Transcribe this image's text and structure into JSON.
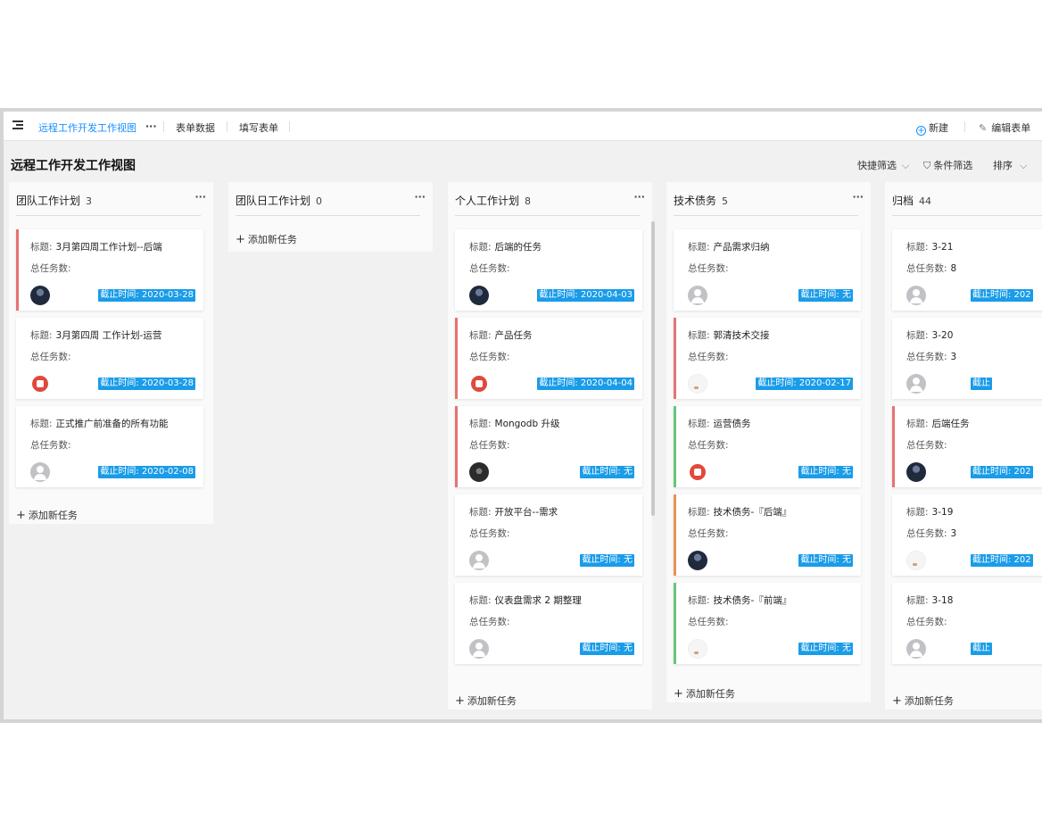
{
  "topbar": {
    "view_name": "远程工作开发工作视图",
    "more": "···",
    "tabs": [
      "表单数据",
      "填写表单"
    ],
    "new_label": "新建",
    "edit_label": "编辑表单"
  },
  "page": {
    "title": "远程工作开发工作视图",
    "quick_filter": "快捷筛选",
    "condition_filter": "条件筛选",
    "sort": "排序"
  },
  "labels": {
    "title_key": "标题:",
    "total_key": "总任务数:",
    "due_prefix": "截止时间:",
    "add_task": "添加新任务"
  },
  "columns": [
    {
      "name": "团队工作计划",
      "count": "3",
      "cards": [
        {
          "title": "3月第四周工作计划--后端",
          "total": "",
          "due": "截止时间: 2020-03-28",
          "bar": "#e57373",
          "avatar": "photo"
        },
        {
          "title": "3月第四周 工作计划-运营",
          "total": "",
          "due": "截止时间: 2020-03-28",
          "bar": "",
          "avatar": "logo"
        },
        {
          "title": "正式推广前准备的所有功能",
          "total": "",
          "due": "截止时间: 2020-02-08",
          "bar": "",
          "avatar": "default"
        }
      ]
    },
    {
      "name": "团队日工作计划",
      "count": "0",
      "cards": []
    },
    {
      "name": "个人工作计划",
      "count": "8",
      "cards": [
        {
          "title": "后端的任务",
          "total": "",
          "due": "截止时间: 2020-04-03",
          "bar": "",
          "avatar": "photo"
        },
        {
          "title": "产品任务",
          "total": "",
          "due": "截止时间: 2020-04-04",
          "bar": "#e57373",
          "avatar": "logo"
        },
        {
          "title": "Mongodb 升级",
          "total": "",
          "due": "截止时间: 无",
          "bar": "#e57373",
          "avatar": "dark"
        },
        {
          "title": "开放平台--需求",
          "total": "",
          "due": "截止时间: 无",
          "bar": "",
          "avatar": "default"
        },
        {
          "title": "仪表盘需求 2 期整理",
          "total": "",
          "due": "截止时间: 无",
          "bar": "",
          "avatar": "default"
        }
      ]
    },
    {
      "name": "技术债务",
      "count": "5",
      "cards": [
        {
          "title": "产品需求归纳",
          "total": "",
          "due": "截止时间: 无",
          "bar": "",
          "avatar": "default"
        },
        {
          "title": "郭清技术交接",
          "total": "",
          "due": "截止时间: 2020-02-17",
          "bar": "#e57373",
          "avatar": "white"
        },
        {
          "title": "运营债务",
          "total": "",
          "due": "截止时间: 无",
          "bar": "#66c77a",
          "avatar": "logo"
        },
        {
          "title": "技术债务-『后端』",
          "total": "",
          "due": "截止时间: 无",
          "bar": "#e8935a",
          "avatar": "photo"
        },
        {
          "title": "技术债务-『前端』",
          "total": "",
          "due": "截止时间: 无",
          "bar": "#66c77a",
          "avatar": "white"
        }
      ]
    },
    {
      "name": "归档",
      "count": "44",
      "cards": [
        {
          "title": "3-21",
          "total": "8",
          "due": "截止时间: 202",
          "bar": "",
          "avatar": "default"
        },
        {
          "title": "3-20",
          "total": "3",
          "due": "截止",
          "bar": "",
          "avatar": "default"
        },
        {
          "title": "后端任务",
          "total": "",
          "due": "截止时间: 202",
          "bar": "#e57373",
          "avatar": "photo"
        },
        {
          "title": "3-19",
          "total": "3",
          "due": "截止时间: 202",
          "bar": "",
          "avatar": "white"
        },
        {
          "title": "3-18",
          "total": "",
          "due": "截止",
          "bar": "",
          "avatar": "default"
        }
      ]
    }
  ]
}
